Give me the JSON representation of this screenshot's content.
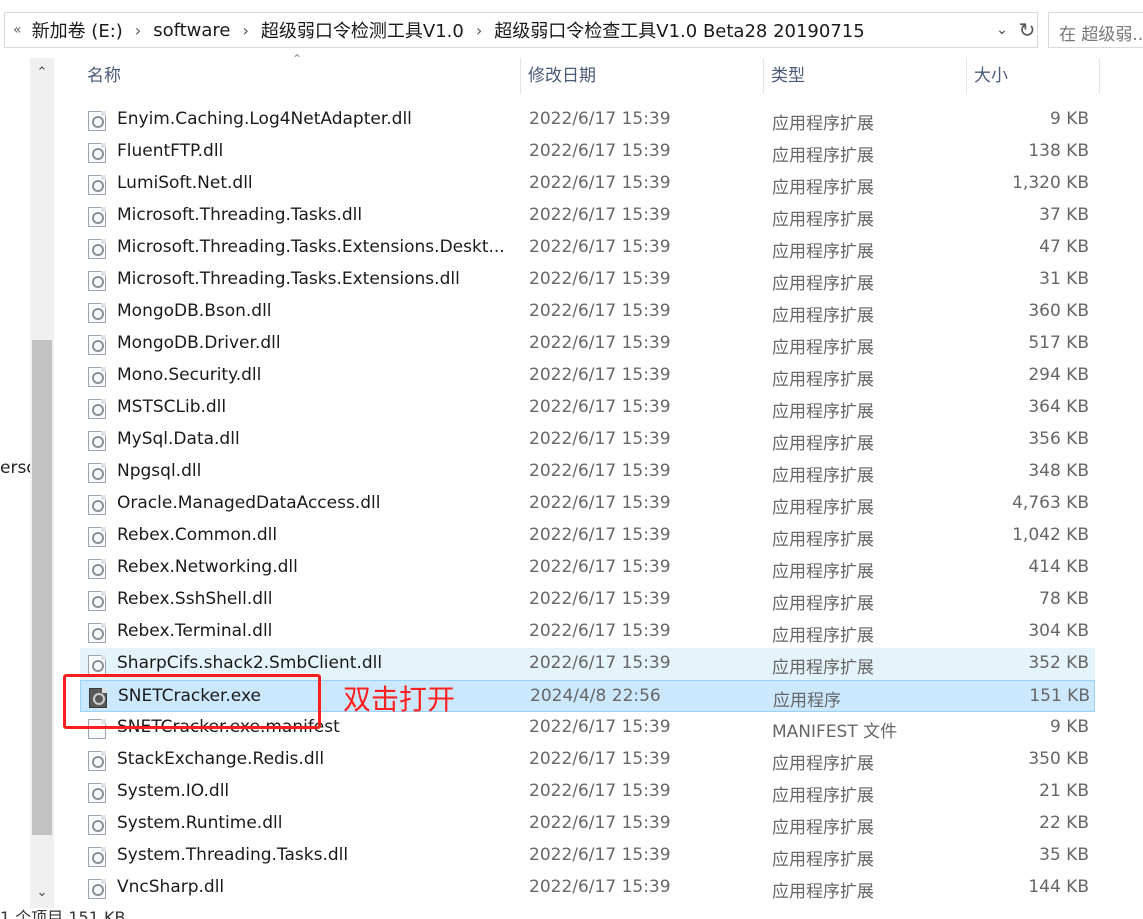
{
  "address_bar": {
    "lead_icon": "chevron-double-left-icon",
    "crumbs": [
      "新加卷 (E:)",
      "software",
      "超级弱口令检测工具V1.0",
      "超级弱口令检查工具V1.0 Beta28 20190715"
    ],
    "dropdown_icon": "chevron-down-icon",
    "refresh_icon": "refresh-icon"
  },
  "search": {
    "placeholder": "在 超级弱..."
  },
  "nav": {
    "partial_text": "erso"
  },
  "columns": {
    "name": "名称",
    "date": "修改日期",
    "type": "类型",
    "size": "大小"
  },
  "files": [
    {
      "name": "Enyim.Caching.Log4NetAdapter.dll",
      "date": "2022/6/17 15:39",
      "type": "应用程序扩展",
      "size": "9 KB",
      "icon": "dll-file-icon"
    },
    {
      "name": "FluentFTP.dll",
      "date": "2022/6/17 15:39",
      "type": "应用程序扩展",
      "size": "138 KB",
      "icon": "dll-file-icon"
    },
    {
      "name": "LumiSoft.Net.dll",
      "date": "2022/6/17 15:39",
      "type": "应用程序扩展",
      "size": "1,320 KB",
      "icon": "dll-file-icon"
    },
    {
      "name": "Microsoft.Threading.Tasks.dll",
      "date": "2022/6/17 15:39",
      "type": "应用程序扩展",
      "size": "37 KB",
      "icon": "dll-file-icon"
    },
    {
      "name": "Microsoft.Threading.Tasks.Extensions.Deskt...",
      "date": "2022/6/17 15:39",
      "type": "应用程序扩展",
      "size": "47 KB",
      "icon": "dll-file-icon"
    },
    {
      "name": "Microsoft.Threading.Tasks.Extensions.dll",
      "date": "2022/6/17 15:39",
      "type": "应用程序扩展",
      "size": "31 KB",
      "icon": "dll-file-icon"
    },
    {
      "name": "MongoDB.Bson.dll",
      "date": "2022/6/17 15:39",
      "type": "应用程序扩展",
      "size": "360 KB",
      "icon": "dll-file-icon"
    },
    {
      "name": "MongoDB.Driver.dll",
      "date": "2022/6/17 15:39",
      "type": "应用程序扩展",
      "size": "517 KB",
      "icon": "dll-file-icon"
    },
    {
      "name": "Mono.Security.dll",
      "date": "2022/6/17 15:39",
      "type": "应用程序扩展",
      "size": "294 KB",
      "icon": "dll-file-icon"
    },
    {
      "name": "MSTSCLib.dll",
      "date": "2022/6/17 15:39",
      "type": "应用程序扩展",
      "size": "364 KB",
      "icon": "dll-file-icon"
    },
    {
      "name": "MySql.Data.dll",
      "date": "2022/6/17 15:39",
      "type": "应用程序扩展",
      "size": "356 KB",
      "icon": "dll-file-icon"
    },
    {
      "name": "Npgsql.dll",
      "date": "2022/6/17 15:39",
      "type": "应用程序扩展",
      "size": "348 KB",
      "icon": "dll-file-icon"
    },
    {
      "name": "Oracle.ManagedDataAccess.dll",
      "date": "2022/6/17 15:39",
      "type": "应用程序扩展",
      "size": "4,763 KB",
      "icon": "dll-file-icon"
    },
    {
      "name": "Rebex.Common.dll",
      "date": "2022/6/17 15:39",
      "type": "应用程序扩展",
      "size": "1,042 KB",
      "icon": "dll-file-icon"
    },
    {
      "name": "Rebex.Networking.dll",
      "date": "2022/6/17 15:39",
      "type": "应用程序扩展",
      "size": "414 KB",
      "icon": "dll-file-icon"
    },
    {
      "name": "Rebex.SshShell.dll",
      "date": "2022/6/17 15:39",
      "type": "应用程序扩展",
      "size": "78 KB",
      "icon": "dll-file-icon"
    },
    {
      "name": "Rebex.Terminal.dll",
      "date": "2022/6/17 15:39",
      "type": "应用程序扩展",
      "size": "304 KB",
      "icon": "dll-file-icon"
    },
    {
      "name": "SharpCifs.shack2.SmbClient.dll",
      "date": "2022/6/17 15:39",
      "type": "应用程序扩展",
      "size": "352 KB",
      "icon": "dll-file-icon",
      "state": "hover"
    },
    {
      "name": "SNETCracker.exe",
      "date": "2024/4/8 22:56",
      "type": "应用程序",
      "size": "151 KB",
      "icon": "exe-app-icon",
      "state": "selected"
    },
    {
      "name": "SNETCracker.exe.manifest",
      "date": "2022/6/17 15:39",
      "type": "MANIFEST 文件",
      "size": "9 KB",
      "icon": "manifest-file-icon"
    },
    {
      "name": "StackExchange.Redis.dll",
      "date": "2022/6/17 15:39",
      "type": "应用程序扩展",
      "size": "350 KB",
      "icon": "dll-file-icon"
    },
    {
      "name": "System.IO.dll",
      "date": "2022/6/17 15:39",
      "type": "应用程序扩展",
      "size": "21 KB",
      "icon": "dll-file-icon"
    },
    {
      "name": "System.Runtime.dll",
      "date": "2022/6/17 15:39",
      "type": "应用程序扩展",
      "size": "22 KB",
      "icon": "dll-file-icon"
    },
    {
      "name": "System.Threading.Tasks.dll",
      "date": "2022/6/17 15:39",
      "type": "应用程序扩展",
      "size": "35 KB",
      "icon": "dll-file-icon"
    },
    {
      "name": "VncSharp.dll",
      "date": "2022/6/17 15:39",
      "type": "应用程序扩展",
      "size": "144 KB",
      "icon": "dll-file-icon"
    }
  ],
  "annotation": {
    "text": "双击打开",
    "color": "#ff2020"
  },
  "status_bar": {
    "text": "1 个项目  151 KB"
  },
  "colors": {
    "hover": "#e5f3fb",
    "selected": "#cce8ff",
    "header_text": "#4a5a7a"
  }
}
